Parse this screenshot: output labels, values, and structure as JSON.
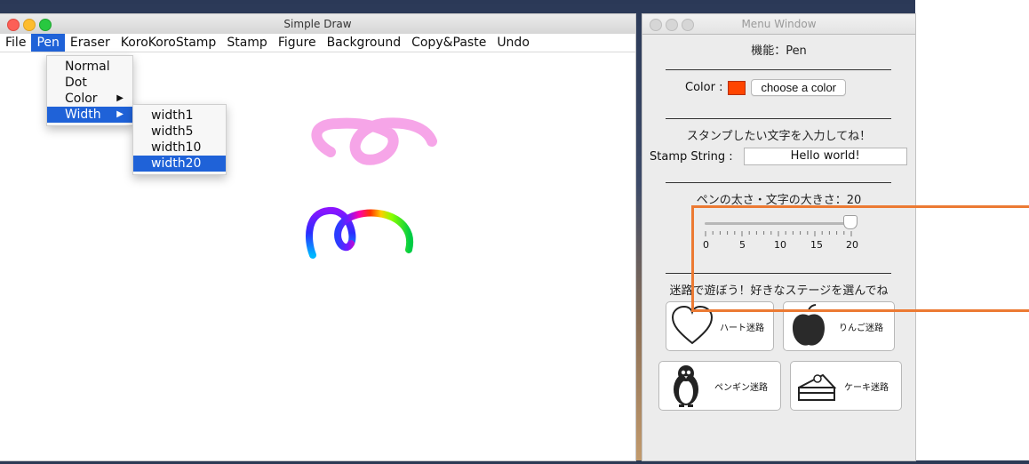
{
  "main_window": {
    "title": "Simple Draw",
    "menus": [
      "File",
      "Pen",
      "Eraser",
      "KoroKoroStamp",
      "Stamp",
      "Figure",
      "Background",
      "Copy&Paste",
      "Undo"
    ],
    "active_menu": "Pen",
    "pen_menu": {
      "items": [
        "Normal",
        "Dot",
        "Color",
        "Width"
      ],
      "selected": "Width"
    },
    "width_submenu": {
      "items": [
        "width1",
        "width5",
        "width10",
        "width20"
      ],
      "selected": "width20"
    }
  },
  "menu_window": {
    "title": "Menu Window",
    "function_label": "機能：Pen",
    "separator": "________________________________",
    "color_label": "Color :",
    "current_color": "#ff4500",
    "choose_color_button": "choose a color",
    "stamp_prompt": "スタンプしたい文字を入力してね！",
    "stamp_label": "Stamp String :",
    "stamp_value": "Hello world!",
    "size_label": "ペンの太さ・文字の大きさ：20",
    "slider": {
      "min": 0,
      "max": 20,
      "value": 20,
      "tick_labels": [
        "0",
        "5",
        "10",
        "15",
        "20"
      ]
    },
    "maze_prompt": "迷路で遊ぼう！好きなステージを選んでね",
    "mazes": {
      "heart": "ハート迷路",
      "apple": "りんご迷路",
      "penguin": "ペンギン迷路",
      "cake": "ケーキ迷路"
    }
  },
  "colors": {
    "menu_highlight": "#1f62d8",
    "annotation_box": "#ec7a33",
    "stroke_pink": "#f59be6"
  }
}
